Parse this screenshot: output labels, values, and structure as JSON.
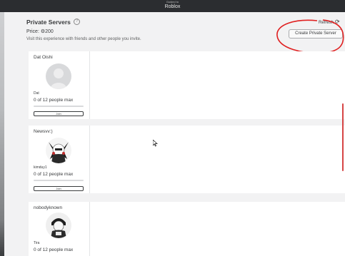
{
  "window": {
    "subtitle": "Guided to",
    "app_name": "Roblox"
  },
  "private_servers": {
    "title": "Private Servers",
    "price_label": "Price:",
    "price_value": "200",
    "description": "Visit this experience with friends and other people you invite.",
    "refresh_label": "Refresh",
    "create_button_label": "Create Private Server"
  },
  "servers": [
    {
      "name": "Dat Oishi",
      "owner": "Dat",
      "count": "0 of 12 people max",
      "fill": 0,
      "join_label": "Join"
    },
    {
      "name": "Newsvv:)",
      "owner": "kimduy1",
      "count": "0 of 12 people max",
      "fill": 0,
      "join_label": "Join"
    },
    {
      "name": "nobodyknown",
      "owner": "Tira",
      "count": "0 of 12 people max",
      "fill": 0,
      "join_label": "Join"
    }
  ],
  "colors": {
    "annotation": "#e02020",
    "background": "#f2f2f3",
    "card": "#ffffff"
  }
}
